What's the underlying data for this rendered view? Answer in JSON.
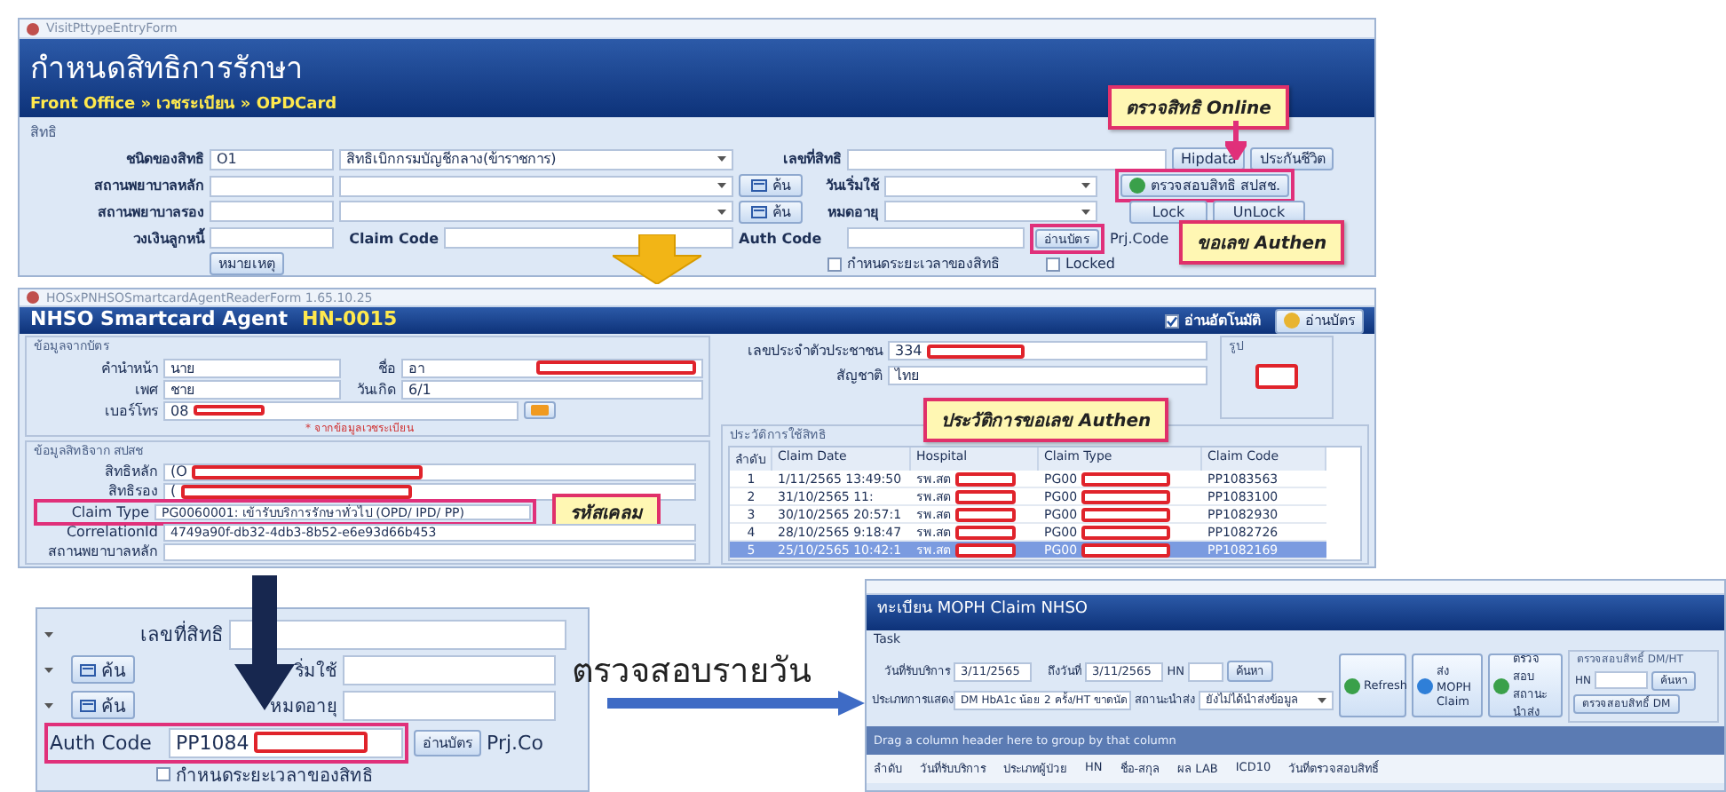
{
  "rights_form": {
    "window_title": "VisitPttypeEntryForm",
    "title": "กำหนดสิทธิการรักษา",
    "breadcrumb": "Front Office » เวชระเบียน » OPDCard",
    "section": "สิทธิ",
    "pttype_label": "ชนิดของสิทธิ",
    "pttype_code": "O1",
    "pttype_name": "สิทธิเบิกกรมบัญชีกลาง(ข้าราชการ)",
    "main_hospital_label": "สถานพยาบาลหลัก",
    "sub_hospital_label": "สถานพยาบาลรอง",
    "credit_label": "วงเงินลูกหนี้",
    "claim_code_label": "Claim Code",
    "note_button": "หมายเหตุ",
    "pttype_no_label": "เลขที่สิทธิ",
    "search_buttons": [
      "ค้น",
      "ค้น"
    ],
    "begin_date_label": "วันเริ่มใช้",
    "expire_label": "หมดอายุ",
    "auth_code_label": "Auth Code",
    "period_checkbox": {
      "label": "กำหนดระยะเวลาของสิทธิ",
      "checked": false
    },
    "hipdata_button": "Hipdata",
    "insurance_button": "ประกันชีวิต",
    "check_online_button": "ตรวจสอบสิทธิ สปสช.",
    "lock_button": "Lock",
    "unlock_button": "UnLock",
    "read_card_button": "อ่านบัตร",
    "prj_code_label": "Prj.Code",
    "locked_checkbox": {
      "label": "Locked",
      "checked": false
    },
    "callouts": [
      "ตรวจสิทธิ Online",
      "ขอเลข Authen"
    ]
  },
  "smartcard": {
    "window_title": "HOSxPNHSOSmartcardAgentReaderForm 1.65.10.25",
    "title": "NHSO Smartcard Agent",
    "hn": "HN-0015",
    "auto_read": {
      "label": "อ่านอัตโนมัติ",
      "checked": true
    },
    "read_button": "อ่านบัตร",
    "card_group": "ข้อมูลจากบัตร",
    "prefix_label": "คำนำหน้า",
    "prefix": "นาย",
    "name_label": "ชื่อ",
    "name": "อา",
    "sex_label": "เพศ",
    "sex": "ชาย",
    "birth_label": "วันเกิด",
    "birth": "6/1",
    "phone_label": "เบอร์โทร",
    "phone": "08",
    "phone_note": "* จากข้อมูลเวชระเบียน",
    "cid_label": "เลขประจำตัวประชาชน",
    "cid": "334",
    "nation_label": "สัญชาติ",
    "nation": "ไทย",
    "photo_label": "รูป",
    "rights_group": "ข้อมูลสิทธิจาก สปสช",
    "main_right_label": "สิทธิหลัก",
    "main_right": "(O",
    "sub_right_label": "สิทธิรอง",
    "sub_right": "(",
    "claim_type_label": "Claim Type",
    "claim_type": "PG0060001: เข้ารับบริการรักษาทั่วไป (OPD/ IPD/ PP)",
    "correlation_label": "CorrelationId",
    "correlation": "4749a90f-db32-4db3-8b52-e6e93d66b453",
    "hospital_label": "สถานพยาบาลหลัก",
    "history_group": "ประวัติการใช้สิทธิ",
    "columns": [
      "ลำดับ",
      "Claim Date",
      "Hospital",
      "Claim Type",
      "Claim Code"
    ],
    "rows": [
      {
        "no": "1",
        "date": "1/11/2565 13:49:50",
        "hospital": "รพ.สต",
        "type": "PG00",
        "code": "PP1083563",
        "selected": false
      },
      {
        "no": "2",
        "date": "31/10/2565 11:",
        "hospital": "รพ.สต",
        "type": "PG00",
        "code": "PP1083100",
        "selected": false
      },
      {
        "no": "3",
        "date": "30/10/2565 20:57:1",
        "hospital": "รพ.สต",
        "type": "PG00",
        "code": "PP1082930",
        "selected": false
      },
      {
        "no": "4",
        "date": "28/10/2565 9:18:47",
        "hospital": "รพ.สต",
        "type": "PG00",
        "code": "PP1082726",
        "selected": false
      },
      {
        "no": "5",
        "date": "25/10/2565 10:42:1",
        "hospital": "รพ.สต",
        "type": "PG00",
        "code": "PP1082169",
        "selected": true
      }
    ],
    "callouts": [
      "รหัสเคลม",
      "ประวัติการขอเลข Authen"
    ]
  },
  "auth_zoom": {
    "pttype_no_label": "เลขที่สิทธิ",
    "search_buttons": [
      "ค้น",
      "ค้น"
    ],
    "begin_date_label": "ริ่มใช้",
    "expire_label": "หมดอายุ",
    "auth_code_label": "Auth Code",
    "auth_code": "PP1084",
    "read_card_button": "อ่านบัตร",
    "prj_code_label": "Prj.Co",
    "period_checkbox": {
      "label": "กำหนดระยะเวลาของสิทธิ",
      "checked": false
    }
  },
  "daily_check_caption": "ตรวจสอบรายวัน",
  "moph_claim": {
    "title": "ทะเบียน MOPH Claim NHSO",
    "task_label": "Task",
    "service_date_label": "วันที่รับบริการ",
    "service_date": "3/11/2565",
    "to_date_label": "ถึงวันที่",
    "to_date": "3/11/2565",
    "hn_label": "HN",
    "search_button": "ค้นหา",
    "display_type_label": "ประเภทการแสดง",
    "display_type": "DM HbA1c น้อย 2 ครั้ง/HT ขาดนัด",
    "send_status_label": "สถานะนำส่ง",
    "send_status": "ยังไม่ได้นำส่งข้อมูล",
    "refresh_button": "Refresh",
    "send_button": "ส่ง MOPH Claim",
    "status_button": "ตรวจสอบ สถานะนำส่ง",
    "dm_group": "ตรวจสอบสิทธิ์ DM/HT",
    "dm_hn_label": "HN",
    "dm_search_button": "ค้นหา",
    "dm_check_button": "ตรวจสอบสิทธิ์ DM",
    "group_hint": "Drag a column header here to group by that column",
    "columns": [
      "ลำดับ",
      "วันที่รับบริการ",
      "ประเภทผู้ป่วย",
      "HN",
      "ชื่อ-สกุล",
      "ผล LAB",
      "ICD10",
      "วันที่ตรวจสอบสิทธิ์"
    ]
  }
}
